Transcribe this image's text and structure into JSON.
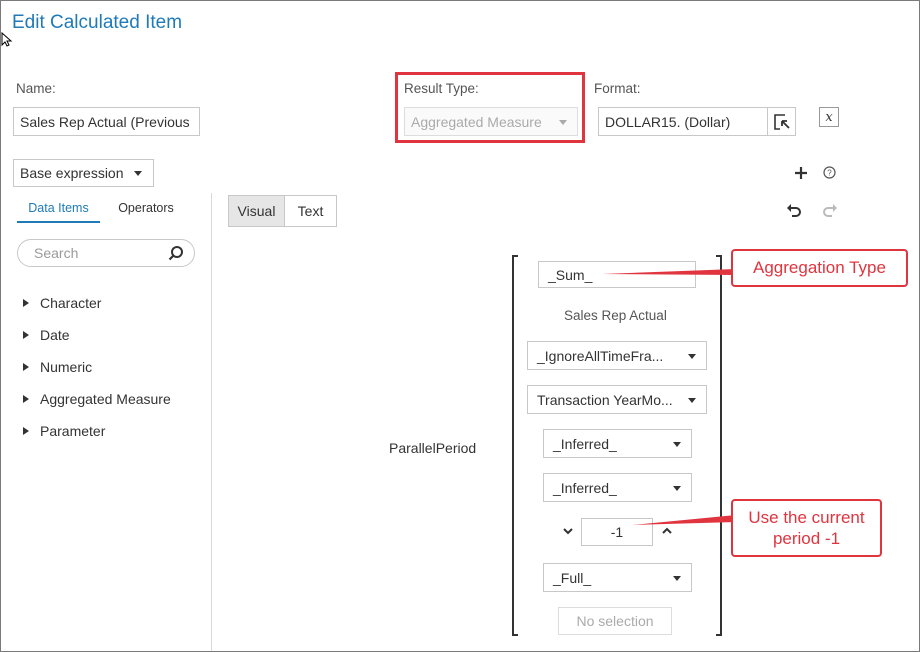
{
  "dialog": {
    "title": "Edit Calculated Item"
  },
  "name_field": {
    "label": "Name:",
    "value": "Sales Rep Actual (Previous"
  },
  "result_type": {
    "label": "Result Type:",
    "value": "Aggregated Measure"
  },
  "format": {
    "label": "Format:",
    "value": "DOLLAR15. (Dollar)"
  },
  "expression_mode": {
    "value": "Base expression"
  },
  "left_tabs": [
    {
      "label": "Data Items"
    },
    {
      "label": "Operators"
    }
  ],
  "view_toggle": [
    {
      "label": "Visual"
    },
    {
      "label": "Text"
    }
  ],
  "search": {
    "placeholder": "Search"
  },
  "tree": [
    {
      "label": "Character"
    },
    {
      "label": "Date"
    },
    {
      "label": "Numeric"
    },
    {
      "label": "Aggregated Measure"
    },
    {
      "label": "Parameter"
    }
  ],
  "expression": {
    "function_name": "ParallelPeriod",
    "aggregation": "_Sum_",
    "measure": "Sales Rep Actual",
    "time_frame": "_IgnoreAllTimeFra...",
    "date_item": "Transaction YearMo...",
    "interval1": "_Inferred_",
    "interval2": "_Inferred_",
    "offset": "-1",
    "period": "_Full_",
    "no_selection": "No selection"
  },
  "callouts": {
    "aggregation_type": "Aggregation Type",
    "current_period": "Use the current period -1"
  },
  "colors": {
    "accent": "#1f7ab8",
    "annotation": "#e0353f"
  },
  "icons": [
    "move-cursor-icon",
    "format-picker-icon",
    "function-x-icon",
    "plus-icon",
    "help-icon",
    "undo-icon",
    "redo-icon",
    "search-icon",
    "chevron-down-icon",
    "chevron-up-icon"
  ]
}
